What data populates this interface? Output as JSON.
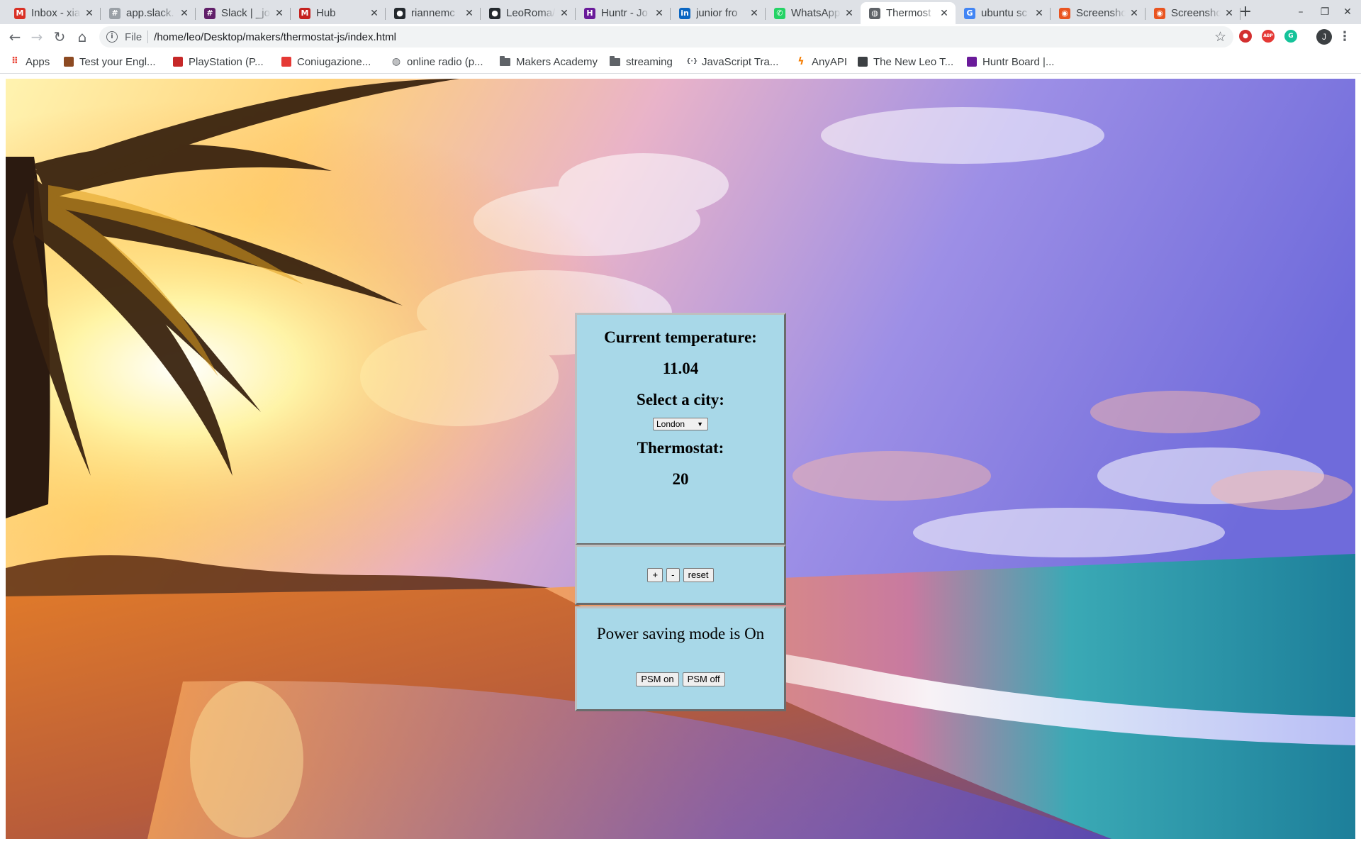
{
  "browser": {
    "tabs": [
      {
        "title": "Inbox - xia",
        "favicon": "gmail-icon",
        "color": "#d93025",
        "glyph": "M"
      },
      {
        "title": "app.slack.",
        "favicon": "slack-icon",
        "color": "#9aa0a6",
        "glyph": "#"
      },
      {
        "title": "Slack | _jo",
        "favicon": "slack-icon",
        "color": "#611f69",
        "glyph": "#"
      },
      {
        "title": "Hub",
        "favicon": "makers-icon",
        "color": "#c5221f",
        "glyph": "M"
      },
      {
        "title": "riannemc",
        "favicon": "github-icon",
        "color": "#24292e",
        "glyph": "●"
      },
      {
        "title": "LeoRoma/",
        "favicon": "github-icon",
        "color": "#24292e",
        "glyph": "●"
      },
      {
        "title": "Huntr - Jo",
        "favicon": "huntr-icon",
        "color": "#6a1b9a",
        "glyph": "H"
      },
      {
        "title": "junior fro",
        "favicon": "linkedin-icon",
        "color": "#0a66c2",
        "glyph": "in"
      },
      {
        "title": "WhatsApp",
        "favicon": "whatsapp-icon",
        "color": "#25d366",
        "glyph": "✆"
      },
      {
        "title": "Thermost",
        "favicon": "globe-icon",
        "color": "#5f6368",
        "glyph": "◍",
        "active": true
      },
      {
        "title": "ubuntu sc",
        "favicon": "google-icon",
        "color": "#4285f4",
        "glyph": "G"
      },
      {
        "title": "Screensho",
        "favicon": "ubuntu-icon",
        "color": "#e95420",
        "glyph": "◉"
      },
      {
        "title": "Screensho",
        "favicon": "ubuntu-icon",
        "color": "#e95420",
        "glyph": "◉"
      }
    ],
    "address": {
      "scheme": "File",
      "url": "/home/leo/Desktop/makers/thermostat-js/index.html"
    },
    "bookmarks": [
      {
        "label": "Apps",
        "icon": "apps-grid-icon",
        "color": "#ea4335"
      },
      {
        "label": "Test your Engl...",
        "icon": "bookmark-favicon",
        "color": "#8d4a22"
      },
      {
        "label": "PlayStation (P...",
        "icon": "bookmark-favicon",
        "color": "#c62828"
      },
      {
        "label": "Coniugazione...",
        "icon": "bookmark-favicon",
        "color": "#e53935"
      },
      {
        "label": "online radio (p...",
        "icon": "globe-icon",
        "color": "#5f6368"
      },
      {
        "label": "Makers Academy",
        "icon": "folder-icon",
        "color": "#5f6368"
      },
      {
        "label": "streaming",
        "icon": "folder-icon",
        "color": "#5f6368"
      },
      {
        "label": "JavaScript Tra...",
        "icon": "braces-icon",
        "color": "#5f6368"
      },
      {
        "label": "AnyAPI",
        "icon": "bolt-icon",
        "color": "#f57c00"
      },
      {
        "label": "The New Leo T...",
        "icon": "bookmark-favicon",
        "color": "#3c4043"
      },
      {
        "label": "Huntr Board |...",
        "icon": "huntr-icon",
        "color": "#6a1b9a"
      }
    ],
    "extensions": [
      {
        "name": "lastpass-icon",
        "color": "#d32f2f",
        "glyph": "●"
      },
      {
        "name": "adblock-icon",
        "color": "#e53935",
        "glyph": "ABP"
      },
      {
        "name": "grammarly-icon",
        "color": "#15c39a",
        "glyph": "G"
      }
    ],
    "profile_initial": "J"
  },
  "thermostat": {
    "current_temp_heading": "Current temperature:",
    "current_temp_value": "11.04",
    "select_city_heading": "Select a city:",
    "city_selected": "London",
    "thermostat_heading": "Thermostat:",
    "thermostat_value": "20",
    "buttons": {
      "up": "+",
      "down": "-",
      "reset": "reset",
      "psm_on": "PSM on",
      "psm_off": "PSM off"
    },
    "psm_status": "Power saving mode is On",
    "panel_color": "#a8d8e8"
  }
}
